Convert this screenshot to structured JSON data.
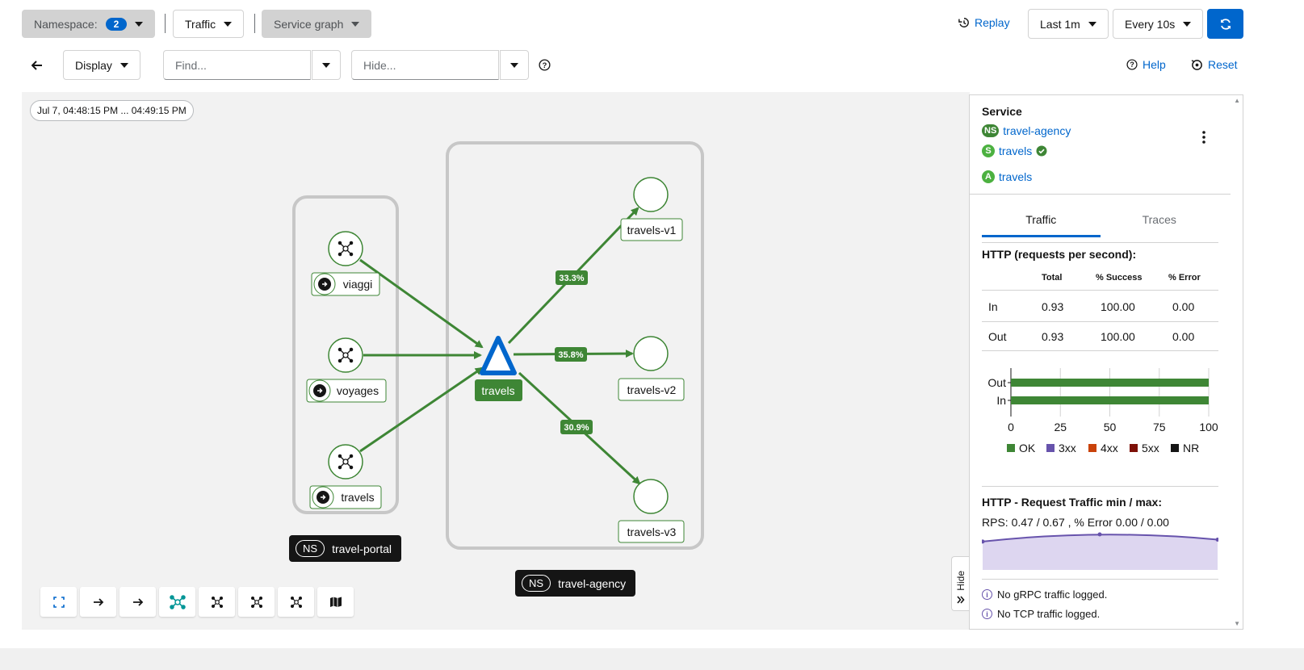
{
  "header": {
    "namespace_label": "Namespace:",
    "namespace_count": "2",
    "traffic_label": "Traffic",
    "graph_type_label": "Service graph",
    "replay_label": "Replay",
    "duration_label": "Last 1m",
    "refresh_label": "Every 10s"
  },
  "toolbar2": {
    "display_label": "Display",
    "find_placeholder": "Find...",
    "hide_placeholder": "Hide...",
    "help_label": "Help",
    "reset_label": "Reset"
  },
  "graph": {
    "time_range": "Jul 7, 04:48:15 PM ... 04:49:15 PM",
    "namespaces": [
      {
        "ns": "NS",
        "name": "travel-portal"
      },
      {
        "ns": "NS",
        "name": "travel-agency"
      }
    ],
    "nodes": {
      "viaggi": "viaggi",
      "voyages": "voyages",
      "travels_portal": "travels",
      "travels_service": "travels",
      "travels_v1": "travels-v1",
      "travels_v2": "travels-v2",
      "travels_v3": "travels-v3"
    },
    "edges": {
      "to_v1": "33.3%",
      "to_v2": "35.8%",
      "to_v3": "30.9%"
    },
    "colors": {
      "edge": "#3e8635",
      "service": "#0066cc",
      "namespace_box": "#c7c7c7"
    }
  },
  "panel": {
    "title": "Service",
    "namespace_badge": "NS",
    "namespace_name": "travel-agency",
    "service_badge": "S",
    "service_name": "travels",
    "app_badge": "A",
    "app_name": "travels",
    "tabs": [
      "Traffic",
      "Traces"
    ],
    "http_title": "HTTP (requests per second):",
    "table_headers": [
      "Total",
      "% Success",
      "% Error"
    ],
    "table_rows": [
      {
        "dir": "In",
        "total": "0.93",
        "success": "100.00",
        "error": "0.00"
      },
      {
        "dir": "Out",
        "total": "0.93",
        "success": "100.00",
        "error": "0.00"
      }
    ],
    "bar_chart": {
      "categories": [
        "Out",
        "In"
      ],
      "ok_values": [
        100,
        100
      ],
      "ticks": [
        "0",
        "25",
        "50",
        "75",
        "100"
      ],
      "legend": [
        "OK",
        "3xx",
        "4xx",
        "5xx",
        "NR"
      ],
      "legend_colors": [
        "#3e8635",
        "#6753ac",
        "#c9420a",
        "#7d1007",
        "#151515"
      ]
    },
    "rps_title": "HTTP - Request Traffic min / max:",
    "rps_text": "RPS: 0.47 / 0.67 , % Error 0.00 / 0.00",
    "sparkline": {
      "values": [
        0.47,
        0.67,
        0.55
      ]
    },
    "no_grpc": "No gRPC traffic logged.",
    "no_tcp": "No TCP traffic logged.",
    "hide_label": "Hide"
  }
}
